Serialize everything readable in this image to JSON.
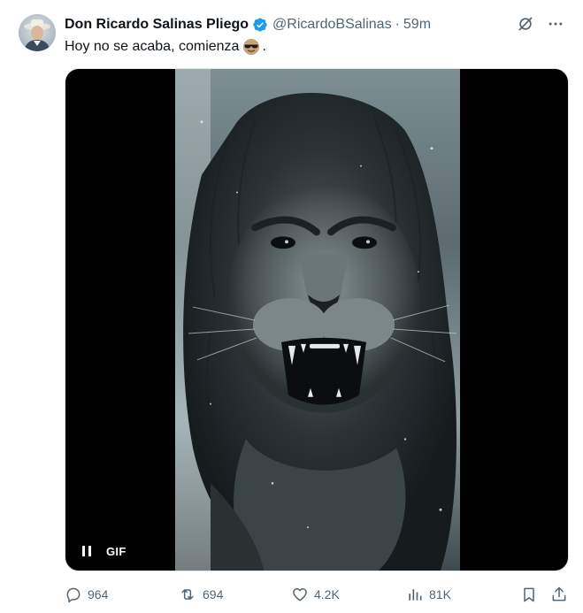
{
  "author": {
    "display_name": "Don Ricardo Salinas Pliego",
    "handle": "@RicardoBSalinas",
    "separator": "·",
    "time": "59m",
    "verified": true,
    "verified_color": "#1d9bf0"
  },
  "tweet": {
    "text": "Hoy no se acaba, comienza",
    "emoji": "sunglasses-face",
    "trailing": "."
  },
  "media": {
    "type": "gif",
    "badge": "GIF",
    "state": "playing",
    "subject": "roaring-lion"
  },
  "header_icons": {
    "grok": "grok-icon",
    "more": "more-icon"
  },
  "actions": {
    "replies": "964",
    "reposts": "694",
    "likes": "4.2K",
    "views": "81K"
  },
  "colors": {
    "text": "#0f1419",
    "secondary": "#536471",
    "media_bg": "#000000"
  }
}
